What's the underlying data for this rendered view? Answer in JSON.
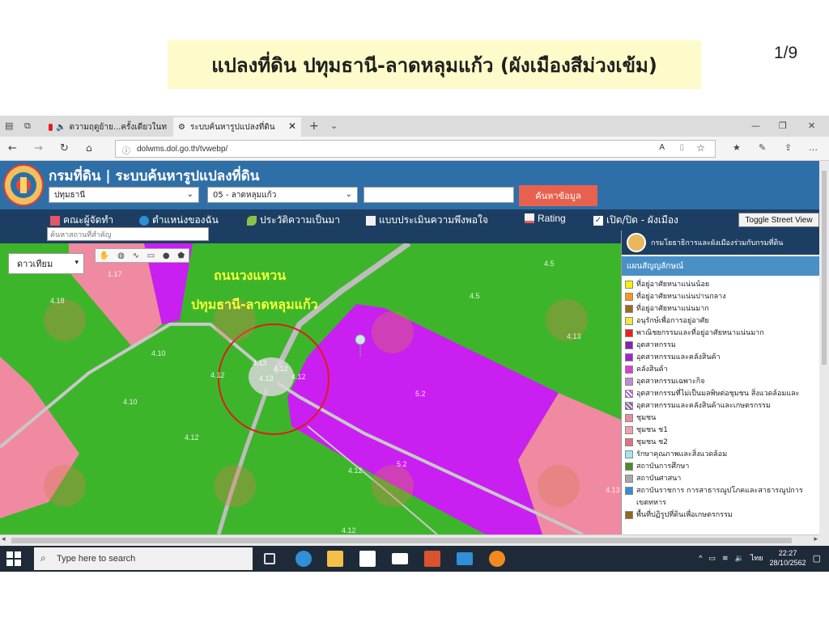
{
  "slide": {
    "title": "แปลงที่ดิน ปทุมธานี-ลาดหลุมแก้ว (ผังเมืองสีม่วงเข้ม)",
    "page": "1/9"
  },
  "browser": {
    "tabs": [
      {
        "label": "ดวามฤดูย้าย...ครั้งเดียวในท"
      },
      {
        "label": "ระบบค้นหารูปแปลงที่ดิน"
      }
    ],
    "url": "dolwms.dol.go.th/tvwebp/"
  },
  "app": {
    "title": "กรมที่ดิน | ระบบค้นหารูปแปลงที่ดิน",
    "province": "ปทุมธานี",
    "district": "05 - ลาดหลุมแก้ว",
    "search_button": "ค้นหาข้อมูล",
    "menu": [
      {
        "label": "คณะผู้จัดทำ",
        "color": "#e0566a"
      },
      {
        "label": "ตำแหน่งของฉัน",
        "color": "#2e8fd8"
      },
      {
        "label": "ประวัติความเป็นมา",
        "color": "#8bc34a"
      },
      {
        "label": "แบบประเมินความพึงพอใจ",
        "color": "#f1f1f1"
      },
      {
        "label": "Rating",
        "color": "#e85a5a"
      },
      {
        "label": "เปิด/ปิด - ผังเมือง",
        "color": "#ffffff"
      }
    ],
    "street_view_button": "Toggle Street View",
    "place_search_placeholder": "ค้นหาสถานที่สำคัญ"
  },
  "map": {
    "basemap": "ดาวเทียม",
    "road_name_line1": "ถนนวงแหวน",
    "road_name_line2": "ปทุมธานี-ลาดหลุมแก้ว",
    "parcel_codes": [
      "1.17",
      "4.18",
      "4.10",
      "4.12",
      "4.10",
      "4.12",
      "4.13",
      "4.12",
      "4.13",
      "4.12",
      "4.5",
      "4.5",
      "4.13",
      "4.12",
      "4.12",
      "5.2",
      "5.2",
      "4.13"
    ]
  },
  "legend": {
    "org": "กรมโยธาธิการและผังเมืองร่วมกับกรมที่ดิน",
    "heading": "แผนสัญญลักษณ์",
    "items": [
      {
        "label": "ที่อยู่อาศัยหนาแน่นน้อย",
        "color": "#f7f300"
      },
      {
        "label": "ที่อยู่อาศัยหนาแน่นปานกลาง",
        "color": "#f59a1e"
      },
      {
        "label": "ที่อยู่อาศัยหนาแน่นมาก",
        "color": "#9c6a20"
      },
      {
        "label": "อนุรักษ์เพื่อการอยู่อาศัย",
        "color": "#e6e070"
      },
      {
        "label": "พาณิชยกรรมและที่อยู่อาศัยหนาแน่นมาก",
        "color": "#ea2020"
      },
      {
        "label": "อุตสาหกรรม",
        "color": "#8e1fb0"
      },
      {
        "label": "อุตสาหกรรมและคลังสินค้า",
        "color": "#a522cf"
      },
      {
        "label": "คลังสินค้า",
        "color": "#d83fd8"
      },
      {
        "label": "อุตสาหกรรมเฉพาะกิจ",
        "color": "#c28ad6"
      },
      {
        "label": "อุตสาหกรรมที่ไม่เป็นมลพิษต่อชุมชน สิ่งแวดล้อมและ",
        "color": "#b04cd8"
      },
      {
        "label": "อุตสาหกรรมและคลังสินค้าและเกษตรกรรม",
        "color": "#7d4aa8"
      },
      {
        "label": "ชุมชน",
        "color": "#ee8a9a"
      },
      {
        "label": "ชุมชน ช1",
        "color": "#f0a0ac"
      },
      {
        "label": "ชุมชน ช2",
        "color": "#e5707f"
      },
      {
        "label": "รักษาคุณภาพและสิ่งแวดล้อม",
        "color": "#9fe6f0"
      },
      {
        "label": "สถาบันการศึกษา",
        "color": "#4c8a2c"
      },
      {
        "label": "สถาบันศาสนา",
        "color": "#a8a8a8"
      },
      {
        "label": "สถาบันราชการ การสาธารณูปโภคและสาธารณูปการ",
        "color": "#2f8fd8"
      },
      {
        "label": "เขตทหาร",
        "color": ""
      },
      {
        "label": "พื้นที่ปฏิรูปที่ดินเพื่อเกษตรกรรม",
        "color": "#8a6a1e"
      }
    ]
  },
  "taskbar": {
    "search_placeholder": "Type here to search",
    "time": "22:27",
    "date": "28/10/2562",
    "lang": "ไทย"
  },
  "colors": {
    "purple_zone": "#c91ff0",
    "pink_zone": "#f08aa0",
    "green_zone": "#3db52b",
    "circle": "#e01b1b"
  }
}
